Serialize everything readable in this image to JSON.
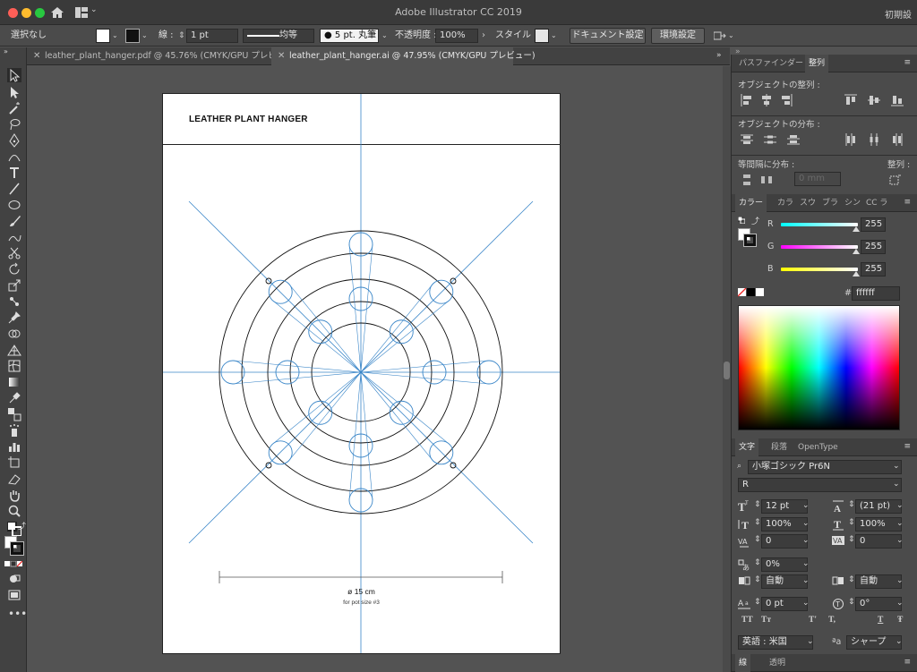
{
  "app": {
    "title": "Adobe Illustrator CC 2019",
    "workspace": "初期設"
  },
  "control": {
    "selection": "選択なし",
    "stroke_label": "線 :",
    "stroke_weight": "1 pt",
    "profile": "均等",
    "brush": "5 pt. 丸筆",
    "opacity_label": "不透明度 :",
    "opacity": "100%",
    "style_label": "スタイル :",
    "doc_settings": "ドキュメント設定",
    "preferences": "環境設定"
  },
  "tabs": [
    {
      "label": "leather_plant_hanger.pdf @ 45.76% (CMYK/GPU プレビュー)"
    },
    {
      "label": "leather_plant_hanger.ai @ 47.95% (CMYK/GPU プレビュー)"
    }
  ],
  "artboard": {
    "heading": "LEATHER PLANT HANGER",
    "dimension": "ø 15 cm",
    "note": "for pot size #3"
  },
  "align_panel": {
    "tab_pathfinder": "パスファインダー",
    "tab_align": "整列",
    "align_objects": "オブジェクトの整列 :",
    "distribute_objects": "オブジェクトの分布 :",
    "distribute_spacing": "等間隔に分布 :",
    "align_to": "整列 :",
    "spacing_value": "0 mm"
  },
  "color_panel": {
    "tabs": [
      "カラー",
      "カラ",
      "スウ",
      "ブラ",
      "シン",
      "CC ラ"
    ],
    "r_label": "R",
    "g_label": "G",
    "b_label": "B",
    "r": "255",
    "g": "255",
    "b": "255",
    "hash": "#",
    "hex": "ffffff"
  },
  "char_panel": {
    "tabs": [
      "文字",
      "段落",
      "OpenType"
    ],
    "font_family": "小塚ゴシック Pr6N",
    "font_style": "R",
    "size": "12 pt",
    "leading": "(21 pt)",
    "v_scale": "100%",
    "h_scale": "100%",
    "kerning": "0",
    "tracking": "0",
    "tsume": "0%",
    "aki_left": "自動",
    "aki_right": "自動",
    "baseline": "0 pt",
    "rotation": "0°",
    "tt1": "TT",
    "tt2": "Tт",
    "tt3": "T'",
    "tt4": "T,",
    "tt5": "T",
    "tt6": "Ŧ",
    "language": "英語 : 米国",
    "aa_label": "ªa",
    "antialias": "シャープ"
  },
  "bottom_panel": {
    "tab_stroke": "線",
    "tab_transparency": "透明"
  }
}
